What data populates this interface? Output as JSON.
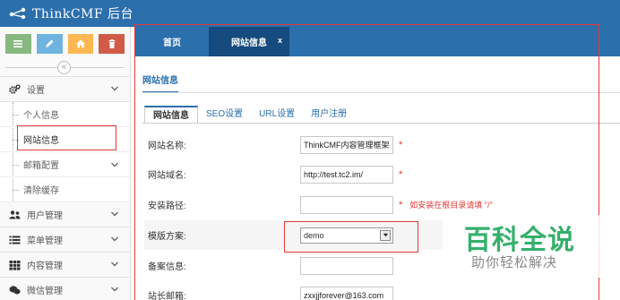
{
  "navbar": {
    "brand": "ThinkCMF 后台"
  },
  "sidebar": {
    "shortcuts": [
      {
        "name": "list",
        "color": "#87b87f"
      },
      {
        "name": "edit",
        "color": "#6fb3e0"
      },
      {
        "name": "home",
        "color": "#ffb752"
      },
      {
        "name": "trash",
        "color": "#d15b47"
      }
    ],
    "settings_label": "设置",
    "sub_items": [
      "个人信息",
      "网站信息",
      "邮箱配置",
      "清除缓存"
    ],
    "menus": [
      "用户管理",
      "菜单管理",
      "内容管理",
      "微信管理"
    ]
  },
  "tabs": {
    "home": "首页",
    "current": "网站信息",
    "close": "x"
  },
  "content": {
    "page_tab": "网站信息",
    "subtabs": [
      "网站信息",
      "SEO设置",
      "URL设置",
      "用户注册"
    ],
    "rows": {
      "site_name": {
        "label": "网站名称:",
        "value": "ThinkCMF内容管理框架",
        "required": "*"
      },
      "site_domain": {
        "label": "网站域名:",
        "value": "http://test.tc2.im/",
        "required": "*"
      },
      "install_path": {
        "label": "安装路径:",
        "value": "",
        "required": "*",
        "hint": "如安装在根目录请填 \"/\""
      },
      "template": {
        "label": "模版方案:",
        "value": "demo"
      },
      "icp": {
        "label": "备案信息:",
        "value": ""
      },
      "admin_email": {
        "label": "站长邮箱:",
        "value": "zxxjjforever@163.com"
      }
    }
  },
  "watermark": {
    "title": "百科全说",
    "subtitle": "助你轻松解决"
  }
}
